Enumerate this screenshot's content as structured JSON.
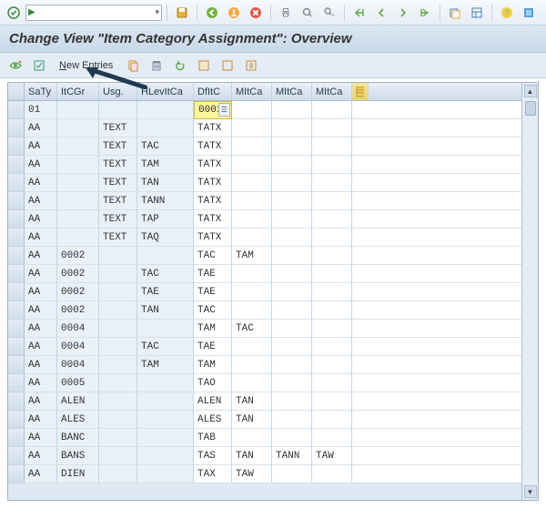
{
  "sys_toolbar": {
    "okcode_value": ""
  },
  "titlebar": {
    "title": "Change View \"Item Category Assignment\": Overview"
  },
  "app_toolbar": {
    "new_entries_label": "New Entries"
  },
  "table": {
    "headers": {
      "saty": "SaTy",
      "itcgr": "ItCGr",
      "usg": "Usg.",
      "hlevitca": "HLevItCa",
      "dfitc": "DfItC",
      "mitca1": "MItCa",
      "mitca2": "MItCa",
      "mitca3": "MItCa"
    },
    "edit_value": "0001",
    "rows": [
      {
        "saty": "01",
        "itcgr": "",
        "usg": "",
        "hlev": "",
        "dfitc": "0001",
        "m1": "",
        "m2": "",
        "m3": ""
      },
      {
        "saty": "AA",
        "itcgr": "",
        "usg": "TEXT",
        "hlev": "",
        "dfitc": "TATX",
        "m1": "",
        "m2": "",
        "m3": ""
      },
      {
        "saty": "AA",
        "itcgr": "",
        "usg": "TEXT",
        "hlev": "TAC",
        "dfitc": "TATX",
        "m1": "",
        "m2": "",
        "m3": ""
      },
      {
        "saty": "AA",
        "itcgr": "",
        "usg": "TEXT",
        "hlev": "TAM",
        "dfitc": "TATX",
        "m1": "",
        "m2": "",
        "m3": ""
      },
      {
        "saty": "AA",
        "itcgr": "",
        "usg": "TEXT",
        "hlev": "TAN",
        "dfitc": "TATX",
        "m1": "",
        "m2": "",
        "m3": ""
      },
      {
        "saty": "AA",
        "itcgr": "",
        "usg": "TEXT",
        "hlev": "TANN",
        "dfitc": "TATX",
        "m1": "",
        "m2": "",
        "m3": ""
      },
      {
        "saty": "AA",
        "itcgr": "",
        "usg": "TEXT",
        "hlev": "TAP",
        "dfitc": "TATX",
        "m1": "",
        "m2": "",
        "m3": ""
      },
      {
        "saty": "AA",
        "itcgr": "",
        "usg": "TEXT",
        "hlev": "TAQ",
        "dfitc": "TATX",
        "m1": "",
        "m2": "",
        "m3": ""
      },
      {
        "saty": "AA",
        "itcgr": "0002",
        "usg": "",
        "hlev": "",
        "dfitc": "TAC",
        "m1": "TAM",
        "m2": "",
        "m3": ""
      },
      {
        "saty": "AA",
        "itcgr": "0002",
        "usg": "",
        "hlev": "TAC",
        "dfitc": "TAE",
        "m1": "",
        "m2": "",
        "m3": ""
      },
      {
        "saty": "AA",
        "itcgr": "0002",
        "usg": "",
        "hlev": "TAE",
        "dfitc": "TAE",
        "m1": "",
        "m2": "",
        "m3": ""
      },
      {
        "saty": "AA",
        "itcgr": "0002",
        "usg": "",
        "hlev": "TAN",
        "dfitc": "TAC",
        "m1": "",
        "m2": "",
        "m3": ""
      },
      {
        "saty": "AA",
        "itcgr": "0004",
        "usg": "",
        "hlev": "",
        "dfitc": "TAM",
        "m1": "TAC",
        "m2": "",
        "m3": ""
      },
      {
        "saty": "AA",
        "itcgr": "0004",
        "usg": "",
        "hlev": "TAC",
        "dfitc": "TAE",
        "m1": "",
        "m2": "",
        "m3": ""
      },
      {
        "saty": "AA",
        "itcgr": "0004",
        "usg": "",
        "hlev": "TAM",
        "dfitc": "TAM",
        "m1": "",
        "m2": "",
        "m3": ""
      },
      {
        "saty": "AA",
        "itcgr": "0005",
        "usg": "",
        "hlev": "",
        "dfitc": "TAO",
        "m1": "",
        "m2": "",
        "m3": ""
      },
      {
        "saty": "AA",
        "itcgr": "ALEN",
        "usg": "",
        "hlev": "",
        "dfitc": "ALEN",
        "m1": "TAN",
        "m2": "",
        "m3": ""
      },
      {
        "saty": "AA",
        "itcgr": "ALES",
        "usg": "",
        "hlev": "",
        "dfitc": "ALES",
        "m1": "TAN",
        "m2": "",
        "m3": ""
      },
      {
        "saty": "AA",
        "itcgr": "BANC",
        "usg": "",
        "hlev": "",
        "dfitc": "TAB",
        "m1": "",
        "m2": "",
        "m3": ""
      },
      {
        "saty": "AA",
        "itcgr": "BANS",
        "usg": "",
        "hlev": "",
        "dfitc": "TAS",
        "m1": "TAN",
        "m2": "TANN",
        "m3": "TAW"
      },
      {
        "saty": "AA",
        "itcgr": "DIEN",
        "usg": "",
        "hlev": "",
        "dfitc": "TAX",
        "m1": "TAW",
        "m2": "",
        "m3": ""
      }
    ]
  }
}
